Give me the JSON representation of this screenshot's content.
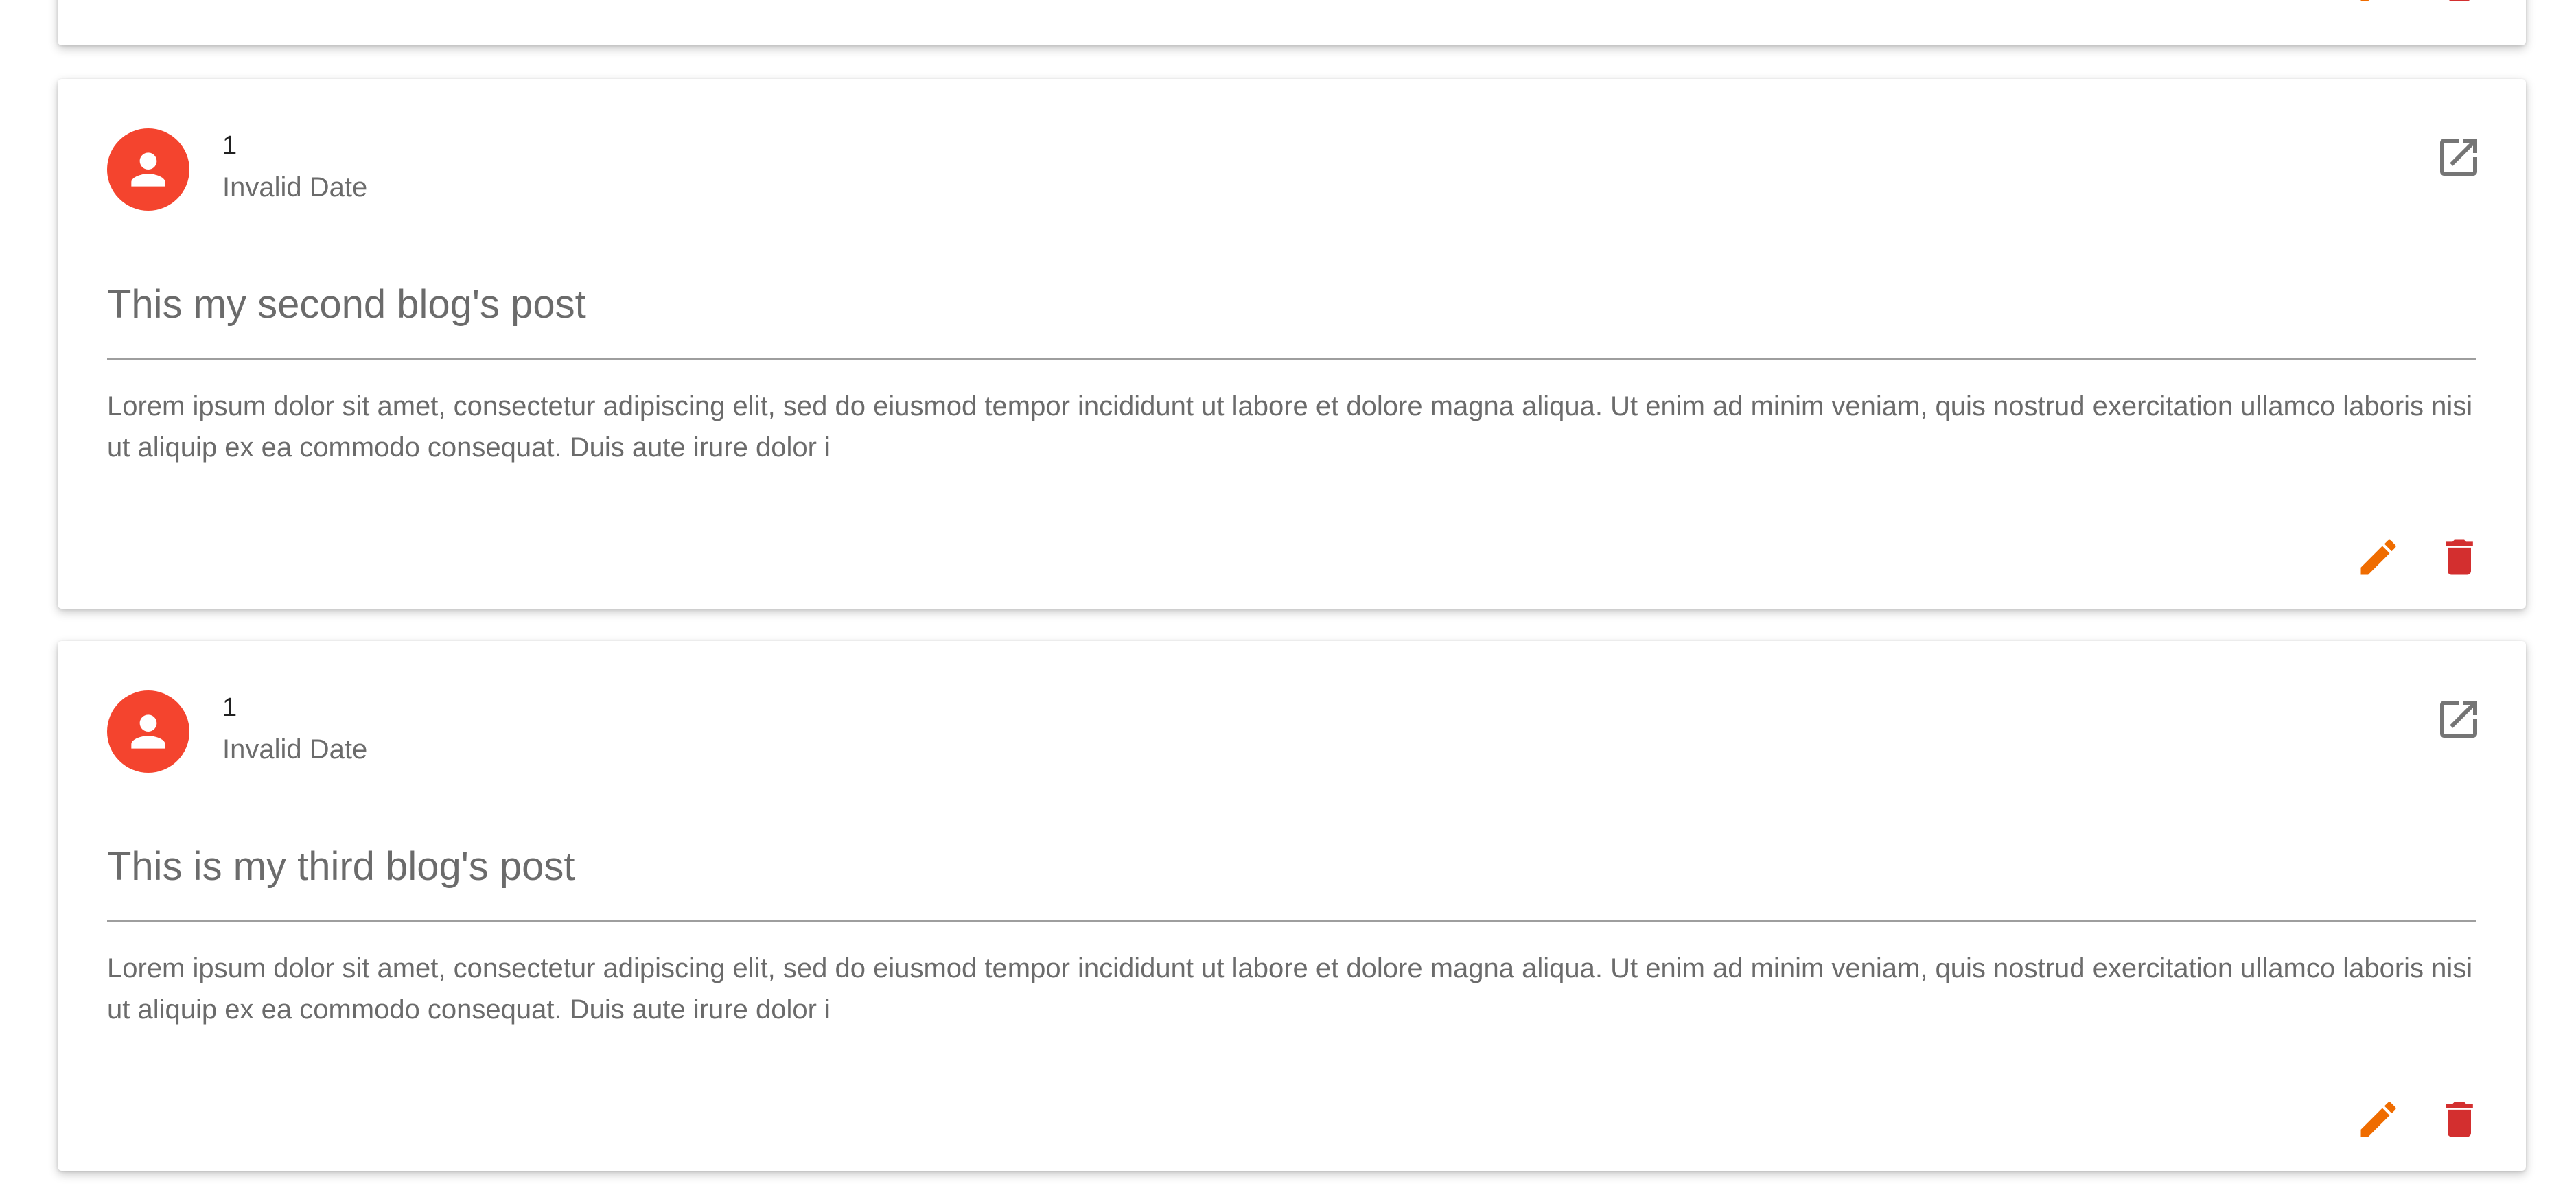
{
  "colors": {
    "avatar_bg": "#f4442e",
    "edit_icon": "#ef6c00",
    "delete_icon": "#d32f2f",
    "muted_text": "#6b6b6b"
  },
  "posts": [
    {
      "author": "1",
      "date": "Invalid Date",
      "title": "This my second blog's post",
      "body": "Lorem ipsum dolor sit amet, consectetur adipiscing elit, sed do eiusmod tempor incididunt ut labore et dolore magna aliqua. Ut enim ad minim veniam, quis nostrud exercitation ullamco laboris nisi ut aliquip ex ea commodo consequat. Duis aute irure dolor i",
      "icons": {
        "avatar": "account-circle-icon",
        "open": "open-in-new-icon",
        "edit": "pencil-icon",
        "delete": "trash-icon"
      }
    },
    {
      "author": "1",
      "date": "Invalid Date",
      "title": "This is my third blog's post",
      "body": "Lorem ipsum dolor sit amet, consectetur adipiscing elit, sed do eiusmod tempor incididunt ut labore et dolore magna aliqua. Ut enim ad minim veniam, quis nostrud exercitation ullamco laboris nisi ut aliquip ex ea commodo consequat. Duis aute irure dolor i",
      "icons": {
        "avatar": "account-circle-icon",
        "open": "open-in-new-icon",
        "edit": "pencil-icon",
        "delete": "trash-icon"
      }
    }
  ]
}
